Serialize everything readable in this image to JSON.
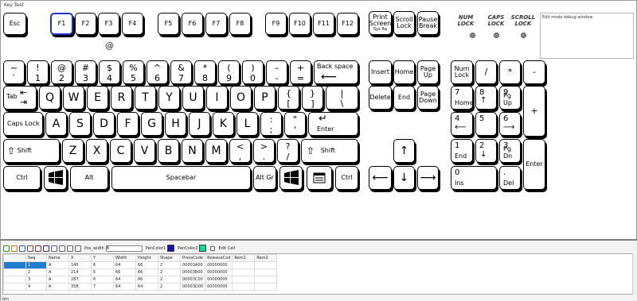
{
  "window": {
    "title": "Key Test",
    "debug_text": "Edit mode debug window",
    "at_symbol": "@"
  },
  "indicators": [
    {
      "label1": "NUM",
      "label2": "LOCK"
    },
    {
      "label1": "CAPS",
      "label2": "LOCK"
    },
    {
      "label1": "SCROLL",
      "label2": "LOCK"
    }
  ],
  "keys": {
    "esc": "Esc",
    "f1": "F1",
    "f2": "F2",
    "f3": "F3",
    "f4": "F4",
    "f5": "F5",
    "f6": "F6",
    "f7": "F7",
    "f8": "F8",
    "f9": "F9",
    "f10": "F10",
    "f11": "F11",
    "f12": "F12",
    "print1": "Print",
    "print2": "Screen",
    "print3": "Sys Rq",
    "scroll1": "Scroll",
    "scroll2": "Lock",
    "pause1": "Pause",
    "pause2": "Break",
    "tilde_top": "~",
    "tilde_bot": "`",
    "n1t": "!",
    "n1b": "1",
    "n2t": "@",
    "n2b": "2",
    "n3t": "#",
    "n3b": "3",
    "n4t": "$",
    "n4b": "4",
    "n5t": "%",
    "n5b": "5",
    "n6t": "^",
    "n6b": "6",
    "n7t": "&",
    "n7b": "7",
    "n8t": "*",
    "n8b": "8",
    "n9t": "(",
    "n9b": "9",
    "n0t": ")",
    "n0b": "0",
    "mint": "–",
    "minb": "-",
    "eqt": "+",
    "eqb": "=",
    "backspace": "Back space",
    "tab": "Tab",
    "q": "Q",
    "w": "W",
    "e": "E",
    "r": "R",
    "t": "T",
    "y": "Y",
    "u": "U",
    "i": "I",
    "o": "O",
    "p": "P",
    "lbt": "{",
    "lbb": "[",
    "rbt": "}",
    "rbb": "]",
    "bst": "|",
    "bsb": "\\",
    "caps": "Caps Lock",
    "a": "A",
    "s": "S",
    "d": "D",
    "f": "F",
    "g": "G",
    "h": "H",
    "j": "J",
    "k": "K",
    "l": "L",
    "sct": ":",
    "scb": ";",
    "qtt": "\"",
    "qtb": "'",
    "enter": "Enter",
    "shift": "Shift",
    "z": "Z",
    "x": "X",
    "c": "C",
    "v": "V",
    "b": "B",
    "n": "N",
    "m": "M",
    "cmt": "<",
    "cmb": ",",
    "pdt": ">",
    "pdb": ".",
    "slt": "?",
    "slb": "/",
    "shift_r": "Shift",
    "ctrl": "Ctrl",
    "alt": "Alt",
    "space": "Spacebar",
    "altgr": "Alt Gr",
    "ctrl_r": "Ctrl",
    "insert": "Insert",
    "home": "Home",
    "pgup1": "Page",
    "pgup2": "Up",
    "delete": "Delete",
    "end": "End",
    "pgdn1": "Page",
    "pgdn2": "Down",
    "numlock1": "Num",
    "numlock2": "Lock",
    "ndiv": "/",
    "nmul": "*",
    "nsub": "-",
    "nadd": "+",
    "n7": "7",
    "n7s": "Home",
    "n8": "8",
    "n9": "9",
    "n9s": "Pg Up",
    "n4": "4",
    "n5": "5",
    "n6": "6",
    "nn1": "1",
    "nn1s": "End",
    "nn2": "2",
    "nn3": "3",
    "nn3s": "Pg Dn",
    "nn0": "0",
    "nn0s": "Ins",
    "ndot": ".",
    "ndots": "Del",
    "nenter": "Enter"
  },
  "toolbar": {
    "pos_width_label": "Pos_width",
    "pos_width_value": "8",
    "pencolor1_label": "PenColor1",
    "pencolor2_label": "PenColor2",
    "edit_cell_label": "Edit Cell"
  },
  "colors": {
    "pencolor1": "#1010c0",
    "pencolor2": "#00e08a",
    "selected_key_border": "#1d33c8",
    "selected_row": "#1e7fd0"
  },
  "table": {
    "headers": [
      "",
      "Seq",
      "Name",
      "X",
      "Y",
      "Width",
      "Height",
      "Shape",
      "PressCode",
      "ReleaseCod",
      "Rem1",
      "Rem2"
    ],
    "rows": [
      [
        "",
        "1",
        "A",
        "145",
        "6",
        "64",
        "66",
        "2",
        "00003A00",
        "00000000",
        "",
        ""
      ],
      [
        "",
        "2",
        "A",
        "214",
        "5",
        "66",
        "66",
        "2",
        "00003B00",
        "00000000",
        "",
        ""
      ],
      [
        "",
        "3",
        "A",
        "287",
        "6",
        "64",
        "66",
        "2",
        "00003C00",
        "00000000",
        "",
        ""
      ],
      [
        "",
        "4",
        "A",
        "358",
        "7",
        "64",
        "64",
        "2",
        "00003D00",
        "00000000",
        "",
        ""
      ]
    ]
  },
  "status": {
    "text": "btn"
  }
}
